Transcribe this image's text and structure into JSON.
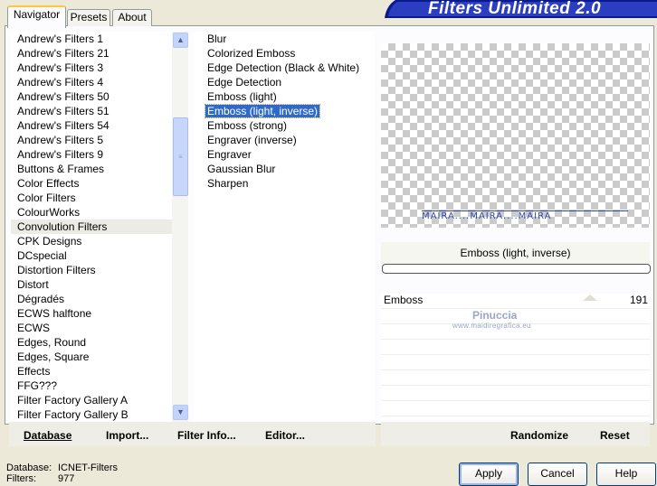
{
  "app": {
    "title": "Filters Unlimited 2.0"
  },
  "tabs": [
    {
      "label": "Navigator",
      "active": true
    },
    {
      "label": "Presets",
      "active": false
    },
    {
      "label": "About",
      "active": false
    }
  ],
  "categories": {
    "items": [
      "Andrew's Filters 1",
      "Andrew's Filters 21",
      "Andrew's Filters 3",
      "Andrew's Filters 4",
      "Andrew's Filters 50",
      "Andrew's Filters 51",
      "Andrew's Filters 54",
      "Andrew's Filters 5",
      "Andrew's Filters 9",
      "Buttons & Frames",
      "Color Effects",
      "Color Filters",
      "ColourWorks",
      "Convolution Filters",
      "CPK Designs",
      "DCspecial",
      "Distortion Filters",
      "Distort",
      "Dégradés",
      "ECWS halftone",
      "ECWS",
      "Edges, Round",
      "Edges, Square",
      "Effects",
      "FFG???",
      "Filter Factory Gallery A",
      "Filter Factory Gallery B"
    ],
    "selected": "Convolution Filters"
  },
  "filters": {
    "items": [
      "Blur",
      "Colorized Emboss",
      "Edge Detection (Black & White)",
      "Edge Detection",
      "Emboss (light)",
      "Emboss (light, inverse)",
      "Emboss (strong)",
      "Engraver (inverse)",
      "Engraver",
      "Gaussian Blur",
      "Sharpen"
    ],
    "selected": "Emboss (light, inverse)"
  },
  "preview": {
    "watermark": "MAIRA....MAIRA....MAIRA"
  },
  "current_filter": "Emboss (light, inverse)",
  "parameters": [
    {
      "name": "Emboss",
      "value": "191"
    }
  ],
  "credit": {
    "name": "Pinuccia",
    "url": "www.maidiregrafica.eu"
  },
  "toolbar": {
    "database": "Database",
    "import": "Import...",
    "filter_info": "Filter Info...",
    "editor": "Editor...",
    "randomize": "Randomize",
    "reset": "Reset"
  },
  "status": {
    "database_label": "Database:",
    "database_value": "ICNET-Filters",
    "filters_label": "Filters:",
    "filters_value": "977"
  },
  "dialog_buttons": {
    "apply": "Apply",
    "cancel": "Cancel",
    "help": "Help"
  }
}
